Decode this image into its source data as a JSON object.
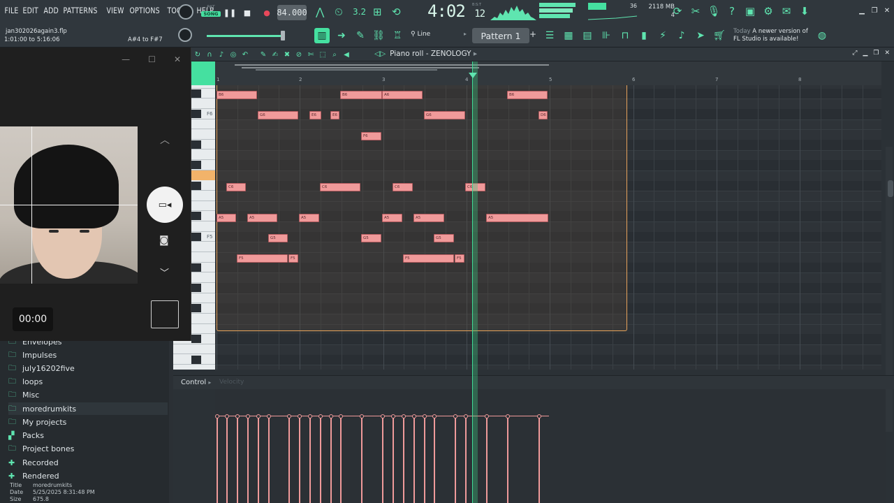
{
  "menu": [
    "FILE",
    "EDIT",
    "ADD",
    "PATTERNS",
    "VIEW",
    "OPTIONS",
    "TOOLS",
    "HELP"
  ],
  "transport": {
    "pat_label": "PAT",
    "song_label": "SONG",
    "tempo": "84.000",
    "snap": "3.2",
    "time_main": "4:02",
    "time_sub": "12",
    "time_unit": "B:S:T"
  },
  "monitor": {
    "cpu_count": "36",
    "memory": "2118 MB",
    "polyphony": "4"
  },
  "file": {
    "name": "jan302026again3.flp",
    "range": "1:01:00 to 5:16:06",
    "note_range": "A#4 to F#7"
  },
  "toolbar2": {
    "snap_mode": "Line",
    "pattern_name": "Pattern 1",
    "news_day": "Today",
    "news_text_1": "A newer version of",
    "news_text_2": "FL Studio is available!"
  },
  "piano_roll": {
    "title": "Piano roll - ZENOLOGY",
    "ruler": [
      "1",
      "2",
      "3",
      "4",
      "5",
      "6",
      "7",
      "8"
    ],
    "key_labels": [
      "F6",
      "F5"
    ],
    "control_label": "Control",
    "control_target": "Velocity",
    "notes": [
      {
        "label": "B6"
      },
      {
        "label": "B6"
      },
      {
        "label": "A6"
      },
      {
        "label": "B6"
      },
      {
        "label": "G6"
      },
      {
        "label": "E6"
      },
      {
        "label": "E6"
      },
      {
        "label": "G6"
      },
      {
        "label": "D6"
      },
      {
        "label": "F6"
      },
      {
        "label": "C6"
      },
      {
        "label": "C6"
      },
      {
        "label": "C6"
      },
      {
        "label": "C6"
      },
      {
        "label": "A5"
      },
      {
        "label": "A5"
      },
      {
        "label": "A5"
      },
      {
        "label": "A5"
      },
      {
        "label": "A5"
      },
      {
        "label": "A5"
      },
      {
        "label": "G5"
      },
      {
        "label": "G5"
      },
      {
        "label": "G5"
      },
      {
        "label": "F5"
      },
      {
        "label": "F5"
      },
      {
        "label": "F5"
      },
      {
        "label": "F5"
      }
    ]
  },
  "browser": {
    "items": [
      "Envelopes",
      "Impulses",
      "july16202five",
      "loops",
      "Misc",
      "moredrumkits",
      "My projects",
      "Packs",
      "Project bones",
      "Recorded",
      "Rendered"
    ],
    "meta": {
      "title_label": "Title",
      "title": "moredrumkits",
      "date_label": "Date",
      "date": "5/25/2025 8:31:48 PM",
      "size_label": "Size",
      "size": "675.8"
    }
  },
  "camera": {
    "timer": "00:00"
  }
}
